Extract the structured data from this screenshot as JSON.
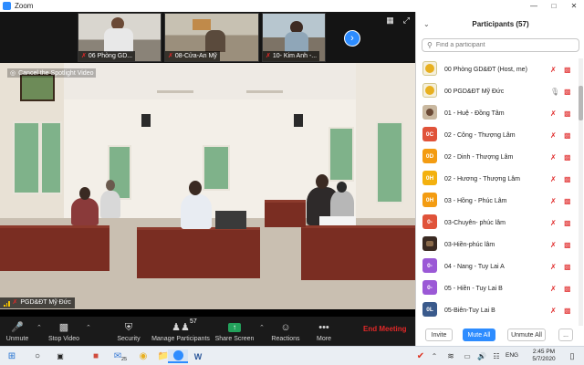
{
  "window": {
    "title": "Zoom"
  },
  "thumbnails": [
    {
      "name": "06 Phòng GD..."
    },
    {
      "name": "08-Cửa-An Mỹ"
    },
    {
      "name": "10- Kim Anh -..."
    }
  ],
  "main_video": {
    "spotlight_label": "Cancel the Spotlight Video",
    "speaker_name": "PGD&ĐT Mỹ Đức"
  },
  "toolbar": {
    "unmute": "Unmute",
    "stop_video": "Stop Video",
    "security": "Security",
    "manage_participants": "Manage Participants",
    "participant_count": "57",
    "share_screen": "Share Screen",
    "reactions": "Reactions",
    "more": "More",
    "end_meeting": "End Meeting"
  },
  "panel": {
    "title": "Participants (57)",
    "search_placeholder": "Find a participant",
    "participants": [
      {
        "initials": "",
        "avatar": "photo-emblem",
        "name": "00 Phòng GD&ĐT (Host, me)",
        "mic": "muted",
        "cam": "off"
      },
      {
        "initials": "",
        "avatar": "photo-emblem",
        "name": "00 PGD&ĐT Mỹ Đức",
        "mic": "active",
        "cam": "off"
      },
      {
        "initials": "",
        "avatar": "photo-person",
        "name": "01 - Huệ - Đồng Tâm",
        "mic": "muted",
        "cam": "off"
      },
      {
        "initials": "0C",
        "avatar_color": "#e0533a",
        "name": "02 - Công - Thượng Lâm",
        "mic": "muted",
        "cam": "off"
      },
      {
        "initials": "0D",
        "avatar_color": "#f39c12",
        "name": "02 - Dinh - Thượng Lâm",
        "mic": "muted",
        "cam": "off"
      },
      {
        "initials": "0H",
        "avatar_color": "#f3b10f",
        "name": "02 - Hương - Thượng Lâm",
        "mic": "muted",
        "cam": "off"
      },
      {
        "initials": "0H",
        "avatar_color": "#f39c12",
        "name": "03 - Hồng - Phúc Lâm",
        "mic": "muted",
        "cam": "off"
      },
      {
        "initials": "0-",
        "avatar_color": "#e0533a",
        "name": "03-Chuyên- phúc lâm",
        "mic": "muted",
        "cam": "off"
      },
      {
        "initials": "",
        "avatar": "photo-dark",
        "name": "03-Hiền-phúc lâm",
        "mic": "muted",
        "cam": "off"
      },
      {
        "initials": "0-",
        "avatar_color": "#9b59d6",
        "name": "04 - Nang - Tuy Lai A",
        "mic": "muted",
        "cam": "off"
      },
      {
        "initials": "0-",
        "avatar_color": "#9b59d6",
        "name": "05 - Hiền - Tuy Lai B",
        "mic": "muted",
        "cam": "off"
      },
      {
        "initials": "0L",
        "avatar_color": "#3a5a8c",
        "name": "05-Biên-Tuy Lai B",
        "mic": "muted",
        "cam": "off"
      }
    ],
    "footer": {
      "invite": "Invite",
      "mute_all": "Mute All",
      "unmute_all": "Unmute All",
      "more": "..."
    }
  },
  "taskbar": {
    "time": "2:45 PM",
    "date": "5/7/2020",
    "lang": "ENG",
    "badge": "25"
  },
  "colors": {
    "zoom_blue": "#2d8cff",
    "end_red": "#e02828",
    "share_green": "#23a15b"
  }
}
